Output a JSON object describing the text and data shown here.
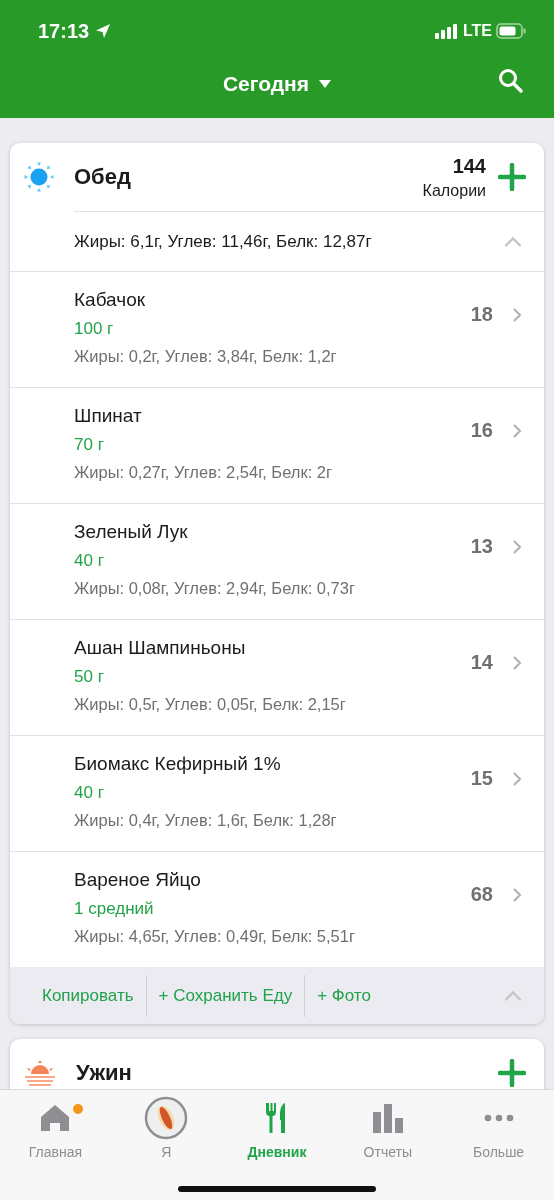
{
  "status_bar": {
    "time": "17:13",
    "network": "LTE"
  },
  "header": {
    "title": "Сегодня"
  },
  "meals": [
    {
      "kind": "lunch",
      "name": "Обед",
      "calories": "144",
      "calories_label": "Калории",
      "expanded": true,
      "macros": "Жиры: 6,1г, Углев: 11,46г, Белк: 12,87г",
      "items": [
        {
          "name": "Кабачок",
          "amount": "100 г",
          "macros": "Жиры: 0,2г, Углев: 3,84г, Белк: 1,2г",
          "calories": "18"
        },
        {
          "name": "Шпинат",
          "amount": "70 г",
          "macros": "Жиры: 0,27г, Углев: 2,54г, Белк: 2г",
          "calories": "16"
        },
        {
          "name": "Зеленый Лук",
          "amount": "40 г",
          "macros": "Жиры: 0,08г, Углев: 2,94г, Белк: 0,73г",
          "calories": "13"
        },
        {
          "name": "Ашан Шампиньоны",
          "amount": "50 г",
          "macros": "Жиры: 0,5г, Углев: 0,05г, Белк: 2,15г",
          "calories": "14"
        },
        {
          "name": "Биомакс Кефирный 1%",
          "amount": "40 г",
          "macros": "Жиры: 0,4г, Углев: 1,6г, Белк: 1,28г",
          "calories": "15"
        },
        {
          "name": "Вареное Яйцо",
          "amount": "1 средний",
          "macros": "Жиры: 4,65г, Углев: 0,49г, Белк: 5,51г",
          "calories": "68"
        }
      ],
      "actions": [
        "Копировать",
        "+ Сохранить Еду",
        "+ Фото"
      ]
    },
    {
      "kind": "dinner",
      "name": "Ужин"
    }
  ],
  "tab_bar": [
    {
      "kind": "home",
      "label": "Главная",
      "selected": false,
      "badge": true
    },
    {
      "kind": "profile",
      "label": "Я",
      "selected": false,
      "badge": false
    },
    {
      "kind": "diary",
      "label": "Дневник",
      "selected": true,
      "badge": false
    },
    {
      "kind": "reports",
      "label": "Отчеты",
      "selected": false,
      "badge": false
    },
    {
      "kind": "more",
      "label": "Больше",
      "selected": false,
      "badge": false
    }
  ]
}
